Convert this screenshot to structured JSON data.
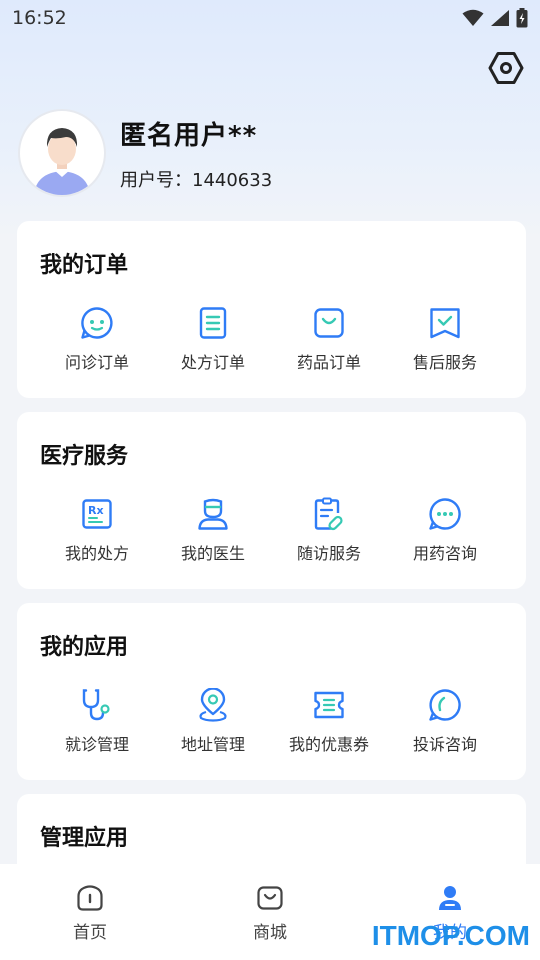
{
  "status_bar": {
    "time": "16:52"
  },
  "profile": {
    "name": "匿名用户**",
    "id_label": "用户号：",
    "id_value": "1440633"
  },
  "sections": [
    {
      "title": "我的订单",
      "items": [
        {
          "label": "问诊订单",
          "icon": "consult-order-icon"
        },
        {
          "label": "处方订单",
          "icon": "prescription-order-icon"
        },
        {
          "label": "药品订单",
          "icon": "medicine-order-icon"
        },
        {
          "label": "售后服务",
          "icon": "after-sales-icon"
        }
      ]
    },
    {
      "title": "医疗服务",
      "items": [
        {
          "label": "我的处方",
          "icon": "rx-icon"
        },
        {
          "label": "我的医生",
          "icon": "doctor-icon"
        },
        {
          "label": "随访服务",
          "icon": "followup-icon"
        },
        {
          "label": "用药咨询",
          "icon": "chat-icon"
        }
      ]
    },
    {
      "title": "我的应用",
      "items": [
        {
          "label": "就诊管理",
          "icon": "stethoscope-icon"
        },
        {
          "label": "地址管理",
          "icon": "location-icon"
        },
        {
          "label": "我的优惠券",
          "icon": "coupon-icon"
        },
        {
          "label": "投诉咨询",
          "icon": "complaint-icon"
        }
      ]
    },
    {
      "title": "管理应用",
      "items": []
    }
  ],
  "tabbar": {
    "tabs": [
      {
        "label": "首页",
        "icon": "home-icon"
      },
      {
        "label": "商城",
        "icon": "shop-bag-icon"
      },
      {
        "label": "我的",
        "icon": "user-icon",
        "active": true
      }
    ]
  },
  "watermark": "ITMOP.COM",
  "colors": {
    "accent": "#2f7cf6",
    "teal": "#36c9b4"
  }
}
